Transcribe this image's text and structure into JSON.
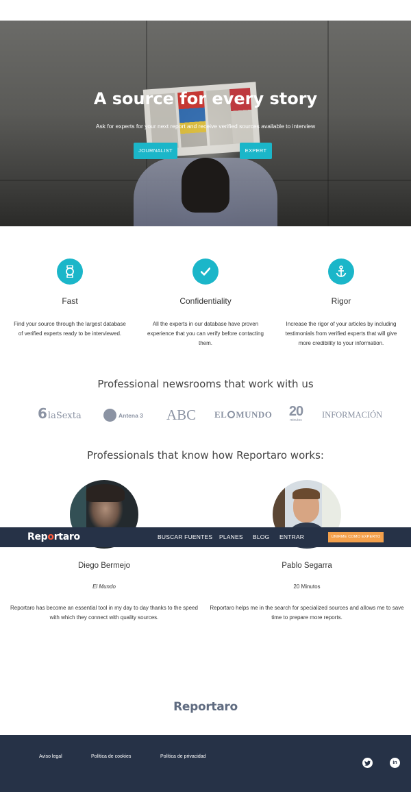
{
  "hero": {
    "title": "A source for every story",
    "subtitle": "Ask for experts for your next report and receive verified sources available to interview",
    "journalist_button": "JOURNALIST",
    "expert_button": "EXPERT"
  },
  "features": [
    {
      "icon": "watch-icon",
      "title": "Fast",
      "text": "Find your source through the largest database of verified experts ready to be interviewed."
    },
    {
      "icon": "checkmark-icon",
      "title": "Confidentiality",
      "text": "All the experts in our database have proven experience that you can verify before contacting them."
    },
    {
      "icon": "anchor-icon",
      "title": "Rigor",
      "text": "Increase the rigor of your articles by including testimonials from verified experts that will give more credibility to your information."
    }
  ],
  "newsrooms": {
    "heading": "Professional newsrooms that work with us",
    "logos": [
      "6",
      "laSexta",
      "Antena 3",
      "ABC",
      "EL",
      "MUNDO",
      "20",
      "minutos",
      "INFORMACIÓN"
    ]
  },
  "professionals": {
    "heading": "Professionals that know how Reportaro works:",
    "items": [
      {
        "name": "Diego Bermejo",
        "outlet": "El Mundo",
        "quote": "Reportaro has become an essential tool in my day to day thanks to the speed with which they connect with quality sources."
      },
      {
        "name": "Pablo Segarra",
        "outlet": "20 Minutos",
        "quote": "Reportaro helps me in the search for specialized sources and allows me to save time to prepare more reports."
      }
    ]
  },
  "nav": {
    "brand_pre": "Rep",
    "brand_o": "o",
    "brand_post": "rtaro",
    "links": [
      "BUSCAR FUENTES",
      "PLANES",
      "BLOG",
      "ENTRAR"
    ],
    "cta": "UNIRME COMO EXPERTO"
  },
  "footer": {
    "brand": "Reportaro",
    "links": [
      "Aviso legal",
      "Política de cookies",
      "Política de privacidad"
    ],
    "social": [
      "twitter-icon",
      "linkedin-icon"
    ]
  },
  "colors": {
    "accent": "#1bb6c9",
    "navy": "#263247",
    "orange": "#f3a04b",
    "logo_gray": "#8b93a3"
  }
}
